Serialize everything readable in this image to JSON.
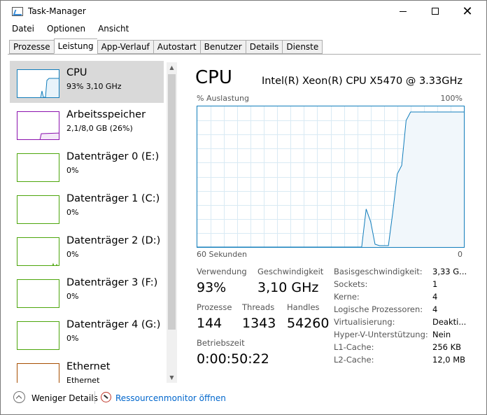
{
  "window": {
    "title": "Task-Manager"
  },
  "menu": [
    "Datei",
    "Optionen",
    "Ansicht"
  ],
  "tabs": [
    "Prozesse",
    "Leistung",
    "App-Verlauf",
    "Autostart",
    "Benutzer",
    "Details",
    "Dienste"
  ],
  "active_tab": "Leistung",
  "sidebar": {
    "items": [
      {
        "title": "CPU",
        "sub": "93%  3,10 GHz",
        "color": "#117dbb"
      },
      {
        "title": "Arbeitsspeicher",
        "sub": "2,1/8,0 GB (26%)",
        "color": "#8b12ae"
      },
      {
        "title": "Datenträger 0 (E:)",
        "sub": "0%",
        "color": "#4da60c"
      },
      {
        "title": "Datenträger 1 (C:)",
        "sub": "0%",
        "color": "#4da60c"
      },
      {
        "title": "Datenträger 2 (D:)",
        "sub": "0%",
        "color": "#4da60c"
      },
      {
        "title": "Datenträger 3 (F:)",
        "sub": "0%",
        "color": "#4da60c"
      },
      {
        "title": "Datenträger 4 (G:)",
        "sub": "0%",
        "color": "#4da60c"
      },
      {
        "title": "Ethernet",
        "sub": "Ethernet",
        "color": "#a74f01"
      }
    ]
  },
  "main": {
    "title": "CPU",
    "cpu_name": "Intel(R) Xeon(R) CPU X5470 @ 3.33GHz",
    "graph_top_left": "% Auslastung",
    "graph_top_right": "100%",
    "graph_bottom_left": "60 Sekunden",
    "graph_bottom_right": "0",
    "graph_color": "#117dbb",
    "utilization_history": [
      0,
      0,
      0,
      0,
      0,
      0,
      0,
      0,
      0,
      0,
      0,
      0,
      0,
      0,
      0,
      0,
      0,
      0,
      0,
      0,
      0,
      0,
      0,
      0,
      0,
      0,
      0,
      0,
      0,
      0,
      0,
      0,
      0,
      0,
      0,
      0,
      0,
      0,
      27,
      18,
      2,
      1,
      1,
      1,
      25,
      52,
      58,
      90,
      96,
      96,
      96,
      96,
      96,
      96,
      96,
      96,
      96,
      96,
      96,
      96,
      96
    ]
  },
  "stats": {
    "utilization_label": "Verwendung",
    "utilization_value": "93%",
    "speed_label": "Geschwindigkeit",
    "speed_value": "3,10 GHz",
    "processes_label": "Prozesse",
    "processes_value": "144",
    "threads_label": "Threads",
    "threads_value": "1343",
    "handles_label": "Handles",
    "handles_value": "54260",
    "uptime_label": "Betriebszeit",
    "uptime_value": "0:00:50:22"
  },
  "info": [
    {
      "label": "Basisgeschwindigkeit:",
      "value": "3,33 G..."
    },
    {
      "label": "Sockets:",
      "value": "1"
    },
    {
      "label": "Kerne:",
      "value": "4"
    },
    {
      "label": "Logische Prozessoren:",
      "value": "4"
    },
    {
      "label": "Virtualisierung:",
      "value": "Deakti..."
    },
    {
      "label": "Hyper-V-Unterstützung:",
      "value": "Nein"
    },
    {
      "label": "L1-Cache:",
      "value": "256 KB"
    },
    {
      "label": "L2-Cache:",
      "value": "12,0 MB"
    }
  ],
  "footer": {
    "fewer_details": "Weniger Details",
    "resource_monitor": "Ressourcenmonitor öffnen"
  }
}
